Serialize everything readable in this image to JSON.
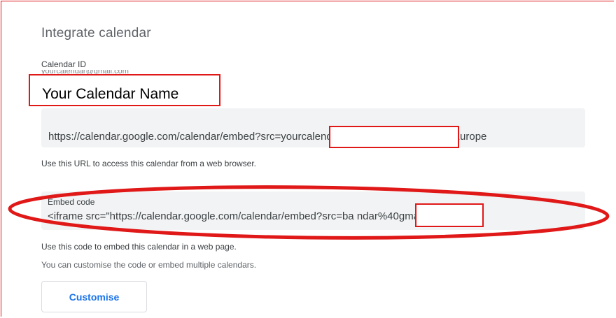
{
  "section": {
    "title": "Integrate calendar"
  },
  "calendar_id": {
    "label": "Calendar ID",
    "value": "yourcalendar@gmail.com"
  },
  "overlay": {
    "calendar_name": "Your Calendar Name"
  },
  "public_url": {
    "value": "https://calendar.google.com/calendar/embed?src=yourcalendarname@gmail.com&ctz=Europe",
    "help": "Use this URL to access this calendar from a web browser."
  },
  "embed": {
    "label": "Embed code",
    "value": "<iframe src=\"https://calendar.google.com/calendar/embed?src=ba                  ndar%40gmail.com",
    "help": "Use this code to embed this calendar in a web page.",
    "help2": "You can customise the code or embed multiple calendars."
  },
  "actions": {
    "customise": "Customise"
  },
  "colors": {
    "annotation": "#e01818",
    "field_bg": "#f1f3f4",
    "accent": "#1a73e8"
  }
}
